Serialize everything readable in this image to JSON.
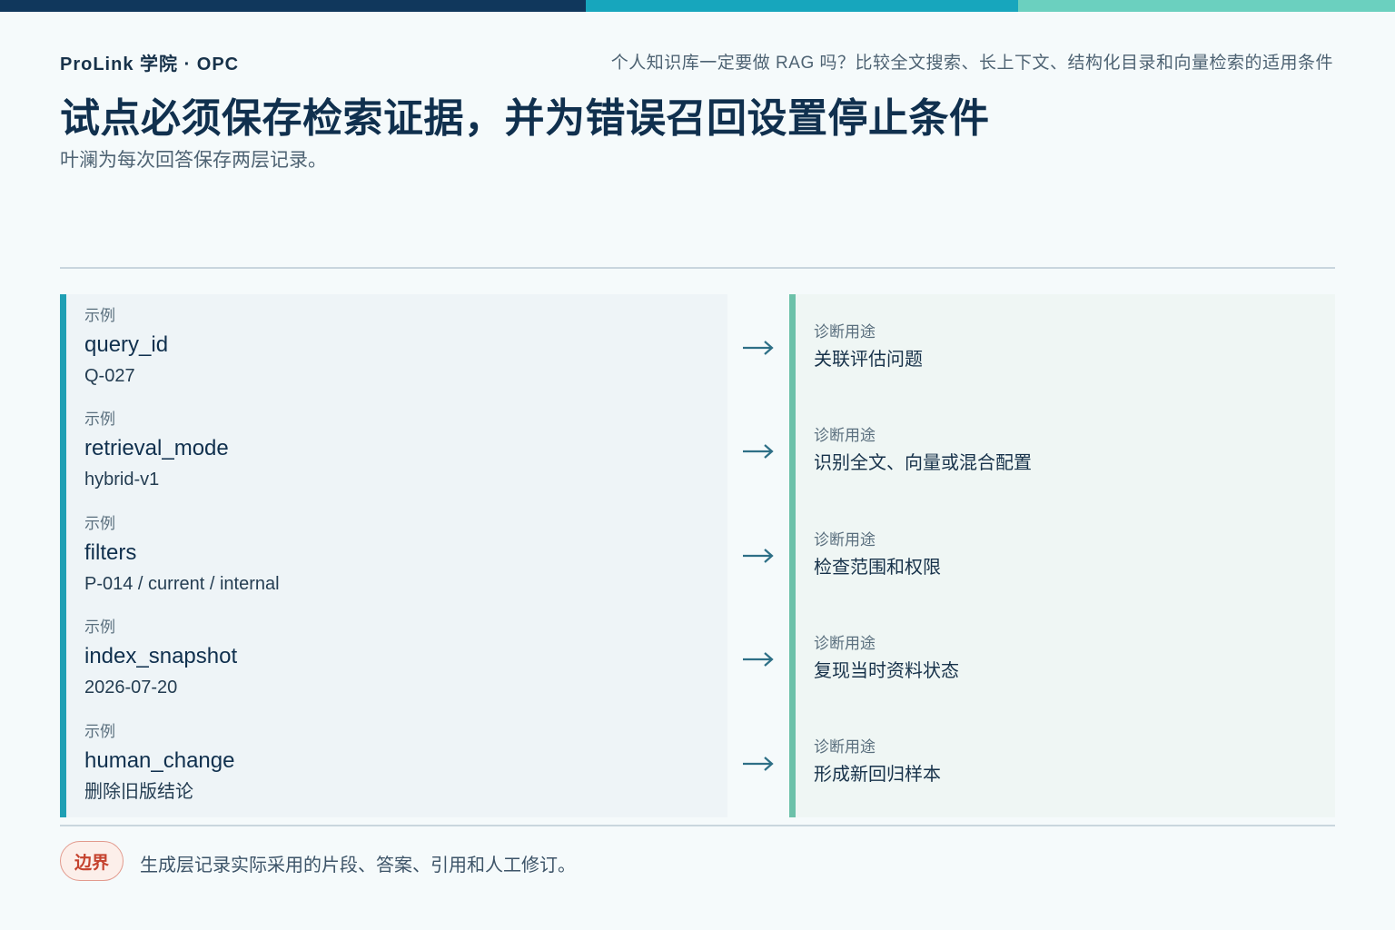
{
  "header": {
    "brand": "ProLink 学院 · OPC",
    "series_title": "个人知识库一定要做 RAG 吗？比较全文搜索、长上下文、结构化目录和向量检索的适用条件",
    "title": "试点必须保存检索证据，并为错误召回设置停止条件",
    "subtitle": "叶澜为每次回答保存两层记录。"
  },
  "colors": {
    "bar_dark": "#10375c",
    "bar_mid": "#17a6bd",
    "bar_light": "#6bd0bf",
    "left_accent": "#1f9fb4",
    "right_accent": "#6cc1a9"
  },
  "rows": [
    {
      "tag": "示例",
      "field": "query_id",
      "example": "Q-027",
      "use_tag": "诊断用途",
      "use": "关联评估问题"
    },
    {
      "tag": "示例",
      "field": "retrieval_mode",
      "example": "hybrid-v1",
      "use_tag": "诊断用途",
      "use": "识别全文、向量或混合配置"
    },
    {
      "tag": "示例",
      "field": "filters",
      "example": "P-014 / current / internal",
      "use_tag": "诊断用途",
      "use": "检查范围和权限"
    },
    {
      "tag": "示例",
      "field": "index_snapshot",
      "example": "2026-07-20",
      "use_tag": "诊断用途",
      "use": "复现当时资料状态"
    },
    {
      "tag": "示例",
      "field": "human_change",
      "example": "删除旧版结论",
      "use_tag": "诊断用途",
      "use": "形成新回归样本"
    }
  ],
  "footer": {
    "badge": "边界",
    "note": "生成层记录实际采用的片段、答案、引用和人工修订。"
  }
}
